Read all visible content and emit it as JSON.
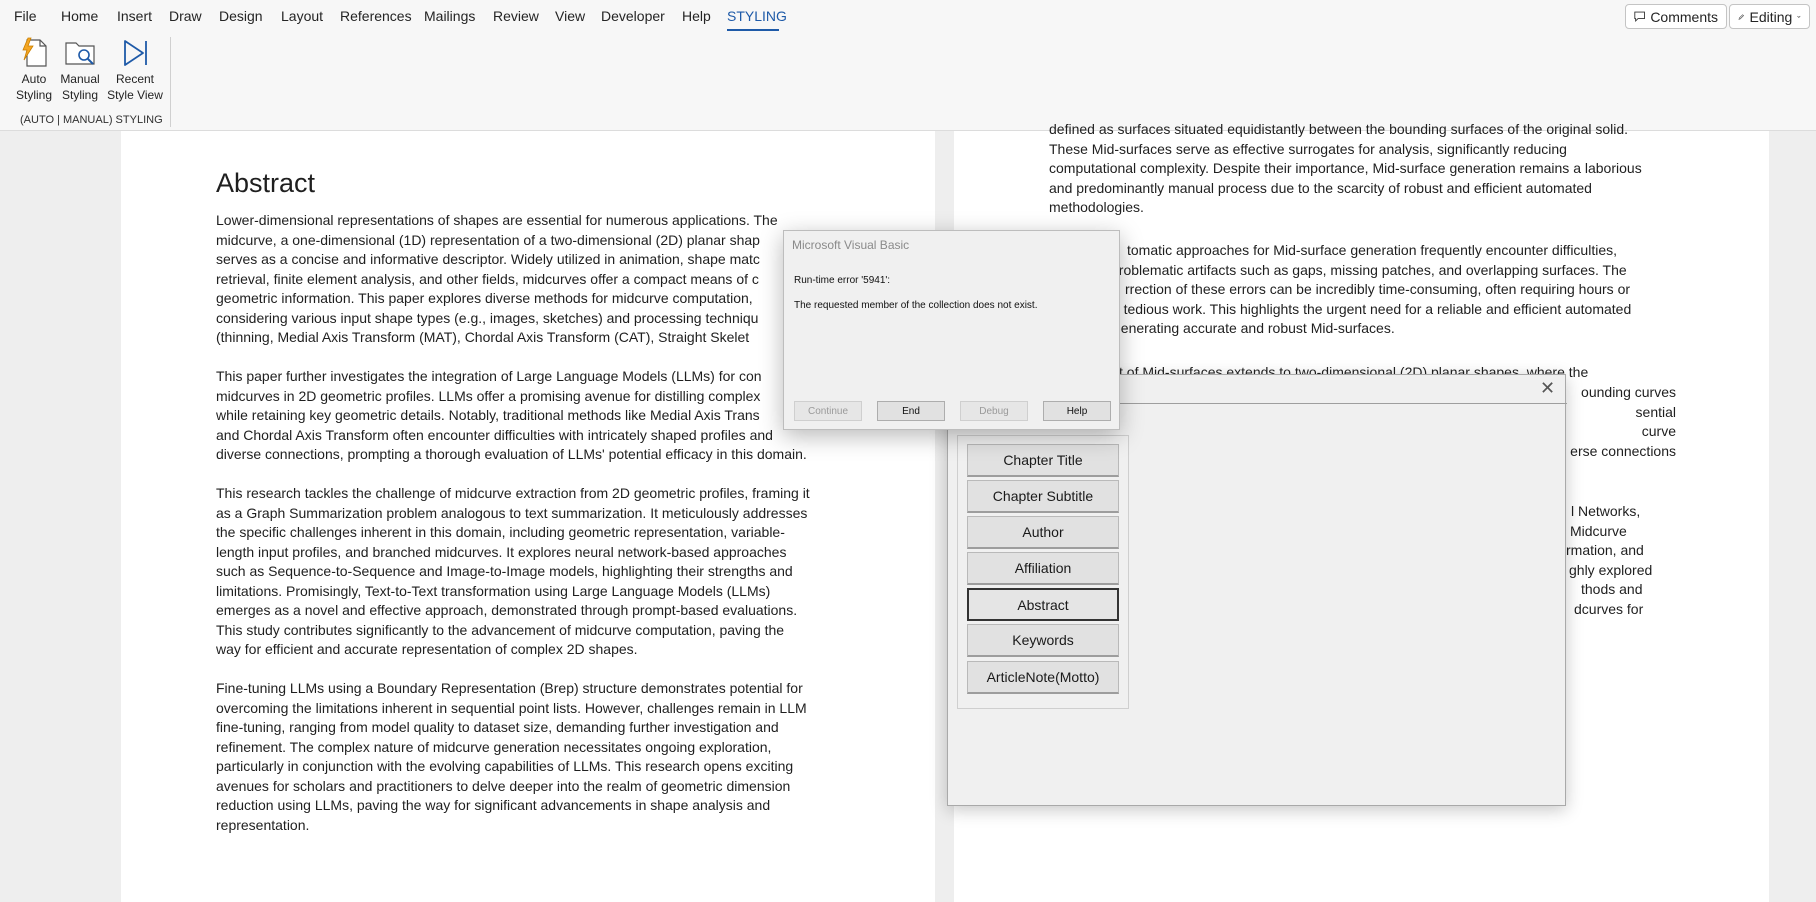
{
  "menu": {
    "items": [
      "File",
      "Home",
      "Insert",
      "Draw",
      "Design",
      "Layout",
      "References",
      "Mailings",
      "Review",
      "View",
      "Developer",
      "Help",
      "STYLING"
    ],
    "comments_label": "Comments",
    "editing_label": "Editing"
  },
  "ribbon": {
    "buttons": [
      {
        "line1": "Auto",
        "line2": "Styling",
        "icon": "auto-styling-icon"
      },
      {
        "line1": "Manual",
        "line2": "Styling",
        "icon": "manual-styling-icon"
      },
      {
        "line1": "Recent",
        "line2": "Style View",
        "icon": "recent-style-view-icon"
      }
    ],
    "group_label": "(AUTO | MANUAL) STYLING"
  },
  "left_page": {
    "title": "Abstract",
    "paragraphs": [
      [
        "Lower-dimensional representations of shapes are essential for numerous applications. The",
        "midcurve, a one-dimensional (1D) representation of a two-dimensional (2D) planar shap",
        "serves as a concise and informative descriptor. Widely utilized in animation, shape matc",
        "retrieval, finite element analysis, and other fields, midcurves offer a compact means of c",
        "geometric information. This paper explores diverse methods for midcurve computation,",
        "considering various input shape types (e.g., images, sketches) and processing techniqu",
        "(thinning, Medial Axis Transform (MAT), Chordal Axis Transform (CAT), Straight Skelet"
      ],
      [
        "This paper further investigates the integration of Large Language Models (LLMs) for con",
        "midcurves in 2D geometric profiles. LLMs offer a promising avenue for distilling complex",
        "while retaining key geometric details. Notably, traditional methods like Medial Axis Trans",
        "and Chordal Axis Transform often encounter difficulties with intricately shaped profiles and",
        "diverse connections, prompting a thorough evaluation of LLMs' potential efficacy in this domain."
      ],
      [
        "This research tackles the challenge of midcurve extraction from 2D geometric profiles, framing it",
        "as a Graph Summarization problem analogous to text summarization. It meticulously addresses",
        "the specific challenges inherent in this domain, including geometric representation, variable-",
        "length input profiles, and branched midcurves. It explores neural network-based approaches",
        "such as Sequence-to-Sequence and Image-to-Image models, highlighting their strengths and",
        "limitations. Promisingly, Text-to-Text transformation using Large Language Models (LLMs)",
        "emerges as a novel and effective approach, demonstrated through prompt-based evaluations.",
        "This study contributes significantly to the advancement of midcurve computation, paving the",
        "way for efficient and accurate representation of complex 2D shapes."
      ],
      [
        "Fine-tuning LLMs using a Boundary Representation (Brep) structure demonstrates potential for",
        "overcoming the limitations inherent in sequential point lists. However, challenges remain in LLM",
        "fine-tuning, ranging from model quality to dataset size, demanding further investigation and",
        "refinement. The complex nature of midcurve generation necessitates ongoing exploration,",
        "particularly in conjunction with the evolving capabilities of LLMs. This research opens exciting",
        "avenues for scholars and practitioners to delve deeper into the realm of geometric dimension",
        "reduction using LLMs, paving the way for significant advancements in shape analysis and",
        "representation."
      ]
    ]
  },
  "right_page": {
    "block1": [
      "defined as surfaces situated equidistantly between the bounding surfaces of the original solid.",
      "These Mid-surfaces serve as effective surrogates for analysis, significantly reducing",
      "computational complexity. Despite their importance, Mid-surface generation remains a laborious",
      "and predominantly manual process due to the scarcity of robust and efficient automated",
      "methodologies."
    ],
    "block2": [
      "tomatic approaches for Mid-surface generation frequently encounter difficulties,",
      "problematic artifacts such as gaps, missing patches, and overlapping surfaces. The",
      "rrection of these errors can be incredibly time-consuming, often requiring hours or",
      "of tedious work. This highlights the urgent need for a reliable and efficient automated",
      "generating accurate and robust Mid-surfaces."
    ],
    "block3_top": "t of Mid-surfaces extends to two-dimensional (2D) planar shapes, where the",
    "block3_right": [
      "ounding curves",
      "sential",
      "curve",
      "erse connections"
    ],
    "block4_right": [
      "l Networks,",
      "Midcurve",
      "rmation, and",
      "ghly explored",
      "thods and",
      "dcurves for"
    ]
  },
  "vb_dialog": {
    "title": "Microsoft Visual Basic",
    "error_line": "Run-time error '5941':",
    "message": "The requested member of the collection does not exist.",
    "buttons": [
      {
        "label": "Continue",
        "enabled": false
      },
      {
        "label": "End",
        "enabled": true
      },
      {
        "label": "Debug",
        "enabled": false
      },
      {
        "label": "Help",
        "enabled": true
      }
    ]
  },
  "style_form": {
    "close_icon": "close-icon",
    "buttons": [
      "Chapter Title",
      "Chapter Subtitle",
      "Author",
      "Affiliation",
      "Abstract",
      "Keywords",
      "ArticleNote(Motto)"
    ],
    "selected": "Abstract"
  }
}
